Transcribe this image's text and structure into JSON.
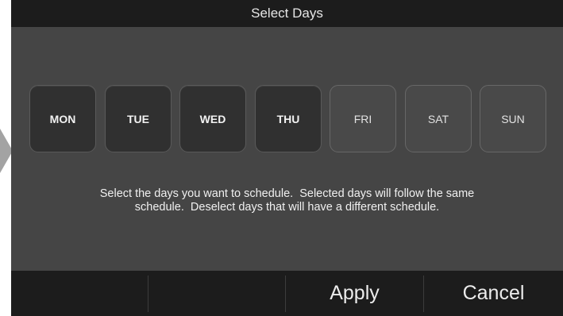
{
  "header": {
    "title": "Select Days"
  },
  "days": [
    {
      "label": "MON",
      "selected": true
    },
    {
      "label": "TUE",
      "selected": true
    },
    {
      "label": "WED",
      "selected": true
    },
    {
      "label": "THU",
      "selected": true
    },
    {
      "label": "FRI",
      "selected": false
    },
    {
      "label": "SAT",
      "selected": false
    },
    {
      "label": "SUN",
      "selected": false
    }
  ],
  "instructions": {
    "line1": "Select the days you want to schedule.  Selected days will follow the same",
    "line2": "schedule.  Deselect days that will have a different schedule."
  },
  "footer": {
    "apply_label": "Apply",
    "cancel_label": "Cancel"
  },
  "colors": {
    "screen_bg": "#454545",
    "bar_bg": "#1c1c1c",
    "day_selected_bg": "#303030",
    "day_unselected_bg": "#494949"
  }
}
